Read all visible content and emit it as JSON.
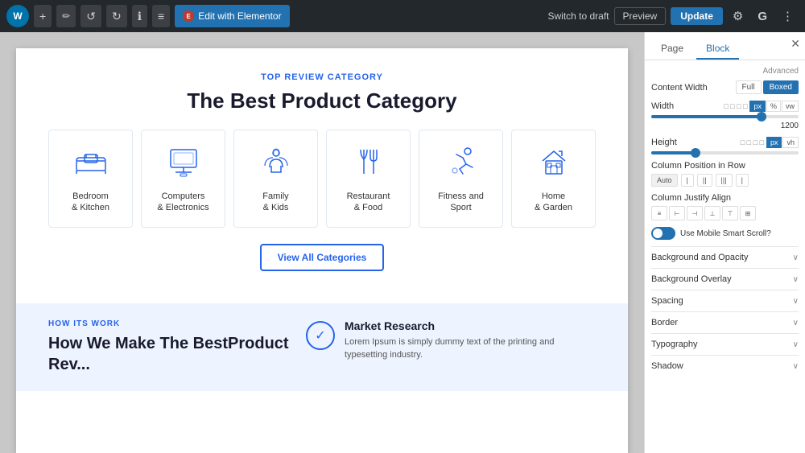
{
  "topbar": {
    "wp_logo": "W",
    "elementor_label": "Edit with Elementor",
    "switch_to_draft": "Switch to draft",
    "preview": "Preview",
    "update": "Update",
    "icons": {
      "plus": "+",
      "pencil": "✏",
      "undo": "↺",
      "redo": "↻",
      "info": "ℹ",
      "hamburger": "≡",
      "gear": "⚙",
      "grammarly": "G",
      "dots": "⋮"
    }
  },
  "page_content": {
    "top_review_label": "TOP REVIEW CATEGORY",
    "best_product_title": "The Best Product Category",
    "categories": [
      {
        "label": "Bedroom\n& Kitchen",
        "icon": "bed"
      },
      {
        "label": "Computers\n& Electronics",
        "icon": "computer"
      },
      {
        "label": "Family\n& Kids",
        "icon": "family"
      },
      {
        "label": "Restaurant\n& Food",
        "icon": "food"
      },
      {
        "label": "Fitness and\nSport",
        "icon": "fitness"
      },
      {
        "label": "Home\n& Garden",
        "icon": "home"
      }
    ],
    "view_all_btn": "View All Categories",
    "second_section": {
      "how_its_work_label": "HOW ITS WORK",
      "how_title": "How We Make The BestProduct\nRev...",
      "market_research_title": "Market Research",
      "market_research_text": "Lorem Ipsum is simply dummy text of the printing and typesetting industry."
    }
  },
  "right_panel": {
    "tab_page": "Page",
    "tab_block": "Block",
    "content_width_label": "Content Width",
    "content_width_options": [
      "Full",
      "Boxed"
    ],
    "content_width_active": "Boxed",
    "width_label": "Width",
    "width_value": "1200",
    "width_fill_percent": 75,
    "width_thumb_percent": 75,
    "height_label": "Height",
    "height_fill_percent": 30,
    "height_thumb_percent": 30,
    "column_position_label": "Column Position in Row",
    "column_position_options": [
      "Auto",
      "|||",
      "||",
      "|",
      "I"
    ],
    "column_justify_label": "Column Justify Align",
    "column_justify_options": [
      "|←",
      "||",
      "||→",
      "||⇔",
      "||⇔",
      "||⇔"
    ],
    "mobile_scroll_label": "Use Mobile Smart Scroll?",
    "accordions": [
      {
        "label": "Background and Opacity"
      },
      {
        "label": "Background Overlay"
      },
      {
        "label": "Spacing"
      },
      {
        "label": "Border"
      },
      {
        "label": "Typography"
      },
      {
        "label": "Shadow"
      }
    ],
    "unit_tabs": [
      "px",
      "%",
      "vw"
    ],
    "unit_tabs_height": [
      "px",
      "vh"
    ]
  }
}
